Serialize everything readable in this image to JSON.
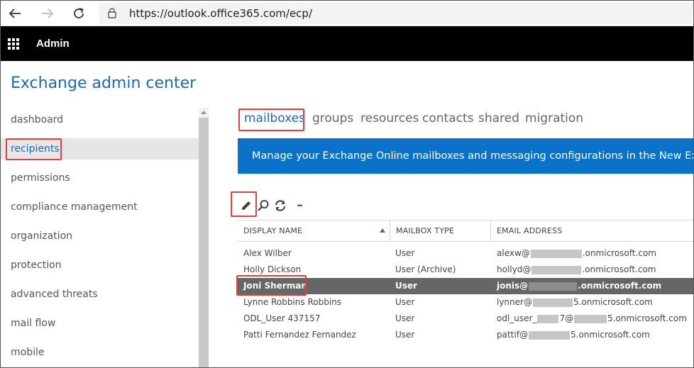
{
  "browser": {
    "url": "https://outlook.office365.com/ecp/"
  },
  "admin_bar": {
    "title": "Admin"
  },
  "page": {
    "title": "Exchange admin center"
  },
  "sidebar": {
    "items": [
      {
        "label": "dashboard"
      },
      {
        "label": "recipients",
        "active": true
      },
      {
        "label": "permissions"
      },
      {
        "label": "compliance management"
      },
      {
        "label": "organization"
      },
      {
        "label": "protection"
      },
      {
        "label": "advanced threats"
      },
      {
        "label": "mail flow"
      },
      {
        "label": "mobile"
      }
    ]
  },
  "tabs": [
    {
      "label": "mailboxes",
      "active": true
    },
    {
      "label": "groups"
    },
    {
      "label": "resources"
    },
    {
      "label": "contacts"
    },
    {
      "label": "shared"
    },
    {
      "label": "migration"
    }
  ],
  "banner": {
    "text": "Manage your Exchange Online mailboxes and messaging configurations in the New Exchange"
  },
  "toolbar": {
    "edit_icon": "pencil-icon",
    "search_icon": "search-icon",
    "refresh_icon": "refresh-icon",
    "more_label": "•••"
  },
  "table": {
    "headers": [
      "DISPLAY NAME",
      "MAILBOX TYPE",
      "EMAIL ADDRESS"
    ],
    "rows": [
      {
        "name": "Alex Wilber",
        "type": "User",
        "email_prefix": "alexw@",
        "email_suffix": ".onmicrosoft.com"
      },
      {
        "name": "Holly Dickson",
        "type": "User (Archive)",
        "email_prefix": "hollyd@",
        "email_suffix": ".onmicrosoft.com"
      },
      {
        "name": "Joni Sherman",
        "type": "User",
        "email_prefix": "jonis@",
        "email_suffix": ".onmicrosoft.com",
        "selected": true
      },
      {
        "name": "Lynne Robbins Robbins",
        "type": "User",
        "email_prefix": "lynner@",
        "email_suffix": "5.onmicrosoft.com"
      },
      {
        "name": "ODL_User 437157",
        "type": "User",
        "email_prefix": "odl_user_",
        "email_mid": "7@",
        "email_suffix": "5.onmicrosoft.com"
      },
      {
        "name": "Patti Fernandez Fernandez",
        "type": "User",
        "email_prefix": "pattif@",
        "email_suffix": "5.onmicrosoft.com"
      }
    ]
  },
  "colors": {
    "accent": "#1a6ab1",
    "banner": "#0a72c8",
    "highlight_box": "#e53e3e",
    "selected_row": "#666666"
  }
}
